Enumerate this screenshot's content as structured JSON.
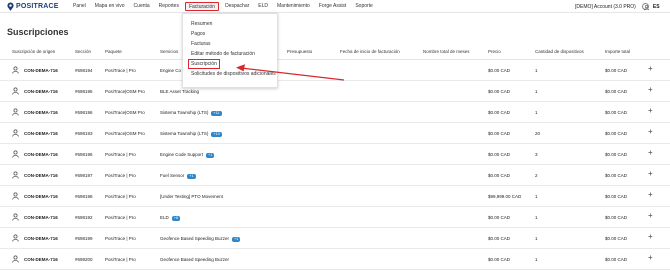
{
  "brand": {
    "name": "POSITRACE",
    "logo_icon": "pin-logo-icon"
  },
  "nav": {
    "items": [
      "Panel",
      "Mapa en vivo",
      "Cuenta",
      "Reportes",
      "Facturación",
      "Despachar",
      "ELD",
      "Mantenimiento",
      "Forge Assist",
      "Soporte"
    ],
    "active": "Facturación"
  },
  "account": {
    "label": "[DEMO] Account (3.0 PRO)",
    "user_icon": "user-icon",
    "lang": "ES"
  },
  "page": {
    "title": "Suscripciones"
  },
  "dropdown": {
    "items": [
      "Resumen",
      "Pagos",
      "Facturas",
      "Editar método de facturación",
      "Suscripción",
      "Solicitudes de dispositivos adicionales"
    ],
    "highlighted": "Suscripción"
  },
  "table": {
    "headers": [
      "Suscripción de origen",
      "Sección",
      "Paquete",
      "Servicios",
      "Presupuesto",
      "Fecha de inicio de facturación",
      "Nombre total de meses",
      "Precio",
      "Cantidad de dispositivos",
      "Importe total"
    ],
    "rows": [
      {
        "origin": "CON-DEMA-716",
        "section": "#698194",
        "package": "PosiTrace | Pro",
        "service": "Engine Co",
        "badge": "",
        "price": "$0.00 CAD",
        "qty": "1",
        "total": "$0.00 CAD"
      },
      {
        "origin": "CON-DEMA-716",
        "section": "#698195",
        "package": "PosiTrace|OSM Pro",
        "service": "BLE Asset Tracking",
        "badge": "",
        "price": "$0.00 CAD",
        "qty": "1",
        "total": "$0.00 CAD"
      },
      {
        "origin": "CON-DEMA-716",
        "section": "#698196",
        "package": "PosiTrace|OSM Pro",
        "service": "Sistema Township (LTS)",
        "badge": "+11",
        "price": "$0.00 CAD",
        "qty": "1",
        "total": "$0.00 CAD"
      },
      {
        "origin": "CON-DEMA-716",
        "section": "#698193",
        "package": "PosiTrace|OSM Pro",
        "service": "Sistema Township (LTS)",
        "badge": "+10",
        "price": "$0.00 CAD",
        "qty": "20",
        "total": "$0.00 CAD"
      },
      {
        "origin": "CON-DEMA-716",
        "section": "#698196",
        "package": "PosiTrace | Pro",
        "service": "Engine Code Support",
        "badge": "+1",
        "price": "$0.00 CAD",
        "qty": "3",
        "total": "$0.00 CAD"
      },
      {
        "origin": "CON-DEMA-716",
        "section": "#698197",
        "package": "PosiTrace | Pro",
        "service": "Fuel Sensor",
        "badge": "+1",
        "price": "$0.00 CAD",
        "qty": "2",
        "total": "$0.00 CAD"
      },
      {
        "origin": "CON-DEMA-716",
        "section": "#698198",
        "package": "PosiTrace | Pro",
        "service": "[Under Testing] PTO Movement",
        "badge": "",
        "price": "$99,999.00 CAD",
        "qty": "1",
        "total": "$0.00 CAD"
      },
      {
        "origin": "CON-DEMA-716",
        "section": "#698192",
        "package": "PosiTrace | Pro",
        "service": "ELD",
        "badge": "+6",
        "price": "$0.00 CAD",
        "qty": "1",
        "total": "$0.00 CAD"
      },
      {
        "origin": "CON-DEMA-716",
        "section": "#698199",
        "package": "PosiTrace | Pro",
        "service": "Geofence Based Speeding Buzzer",
        "badge": "+1",
        "price": "$0.00 CAD",
        "qty": "1",
        "total": "$0.00 CAD"
      },
      {
        "origin": "CON-DEMA-716",
        "section": "#698200",
        "package": "PosiTrace | Pro",
        "service": "Geofence Based Speeding Buzzer",
        "badge": "",
        "price": "$0.00 CAD",
        "qty": "1",
        "total": "$0.00 CAD"
      }
    ],
    "row_icon": "user-icon",
    "expand_icon": "plus-icon",
    "expand_symbol": "+"
  },
  "colors": {
    "accent": "#d7282f",
    "brand": "#1d3f73",
    "badge": "#2f86c9"
  }
}
